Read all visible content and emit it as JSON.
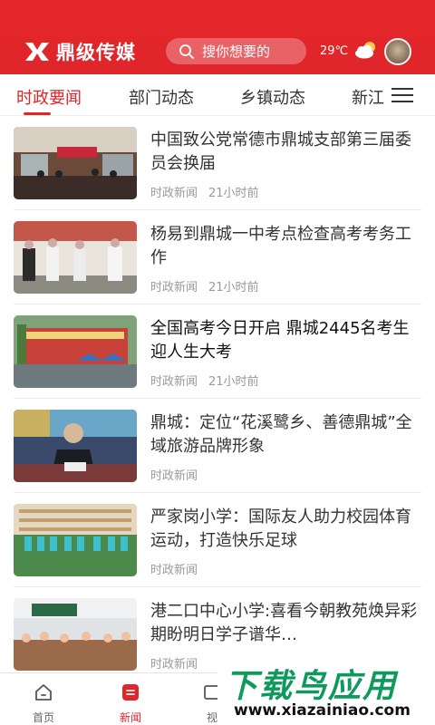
{
  "header": {
    "logo_text": "鼎级传媒",
    "search_placeholder": "搜你想要的",
    "temperature": "29℃",
    "weather_icon": "partly-cloudy-icon",
    "colors": {
      "brand": "#e0262b"
    }
  },
  "tabs": [
    {
      "label": "时政要闻",
      "active": true
    },
    {
      "label": "部门动态",
      "active": false
    },
    {
      "label": "乡镇动态",
      "active": false
    },
    {
      "label": "新江",
      "active": false
    }
  ],
  "news": [
    {
      "title": "中国致公党常德市鼎城支部第三届委员会换届",
      "category": "时政新闻",
      "time": "21小时前"
    },
    {
      "title": "杨易到鼎城一中考点检查高考考务工作",
      "category": "时政新闻",
      "time": "21小时前"
    },
    {
      "title": "全国高考今日开启 鼎城2445名考生迎人生大考",
      "category": "时政新闻",
      "time": "21小时前"
    },
    {
      "title": "鼎城：定位“花溪鹭乡、善德鼎城”全域旅游品牌形象",
      "category": "时政新闻",
      "time": ""
    },
    {
      "title": "严家岗小学：国际友人助力校园体育运动，打造快乐足球",
      "category": "时政新闻",
      "time": ""
    },
    {
      "title": "港二口中心小学:喜看今朝教苑焕异彩 期盼明日学子谱华…",
      "category": "时政新闻",
      "time": ""
    }
  ],
  "bottom_nav": [
    {
      "label": "首页",
      "icon": "home-icon",
      "active": false
    },
    {
      "label": "新闻",
      "icon": "news-icon",
      "active": true
    },
    {
      "label": "视",
      "icon": "video-icon",
      "active": false
    }
  ],
  "watermark": {
    "title": "下载鸟应用",
    "url": "www.xiazainiao.com"
  }
}
